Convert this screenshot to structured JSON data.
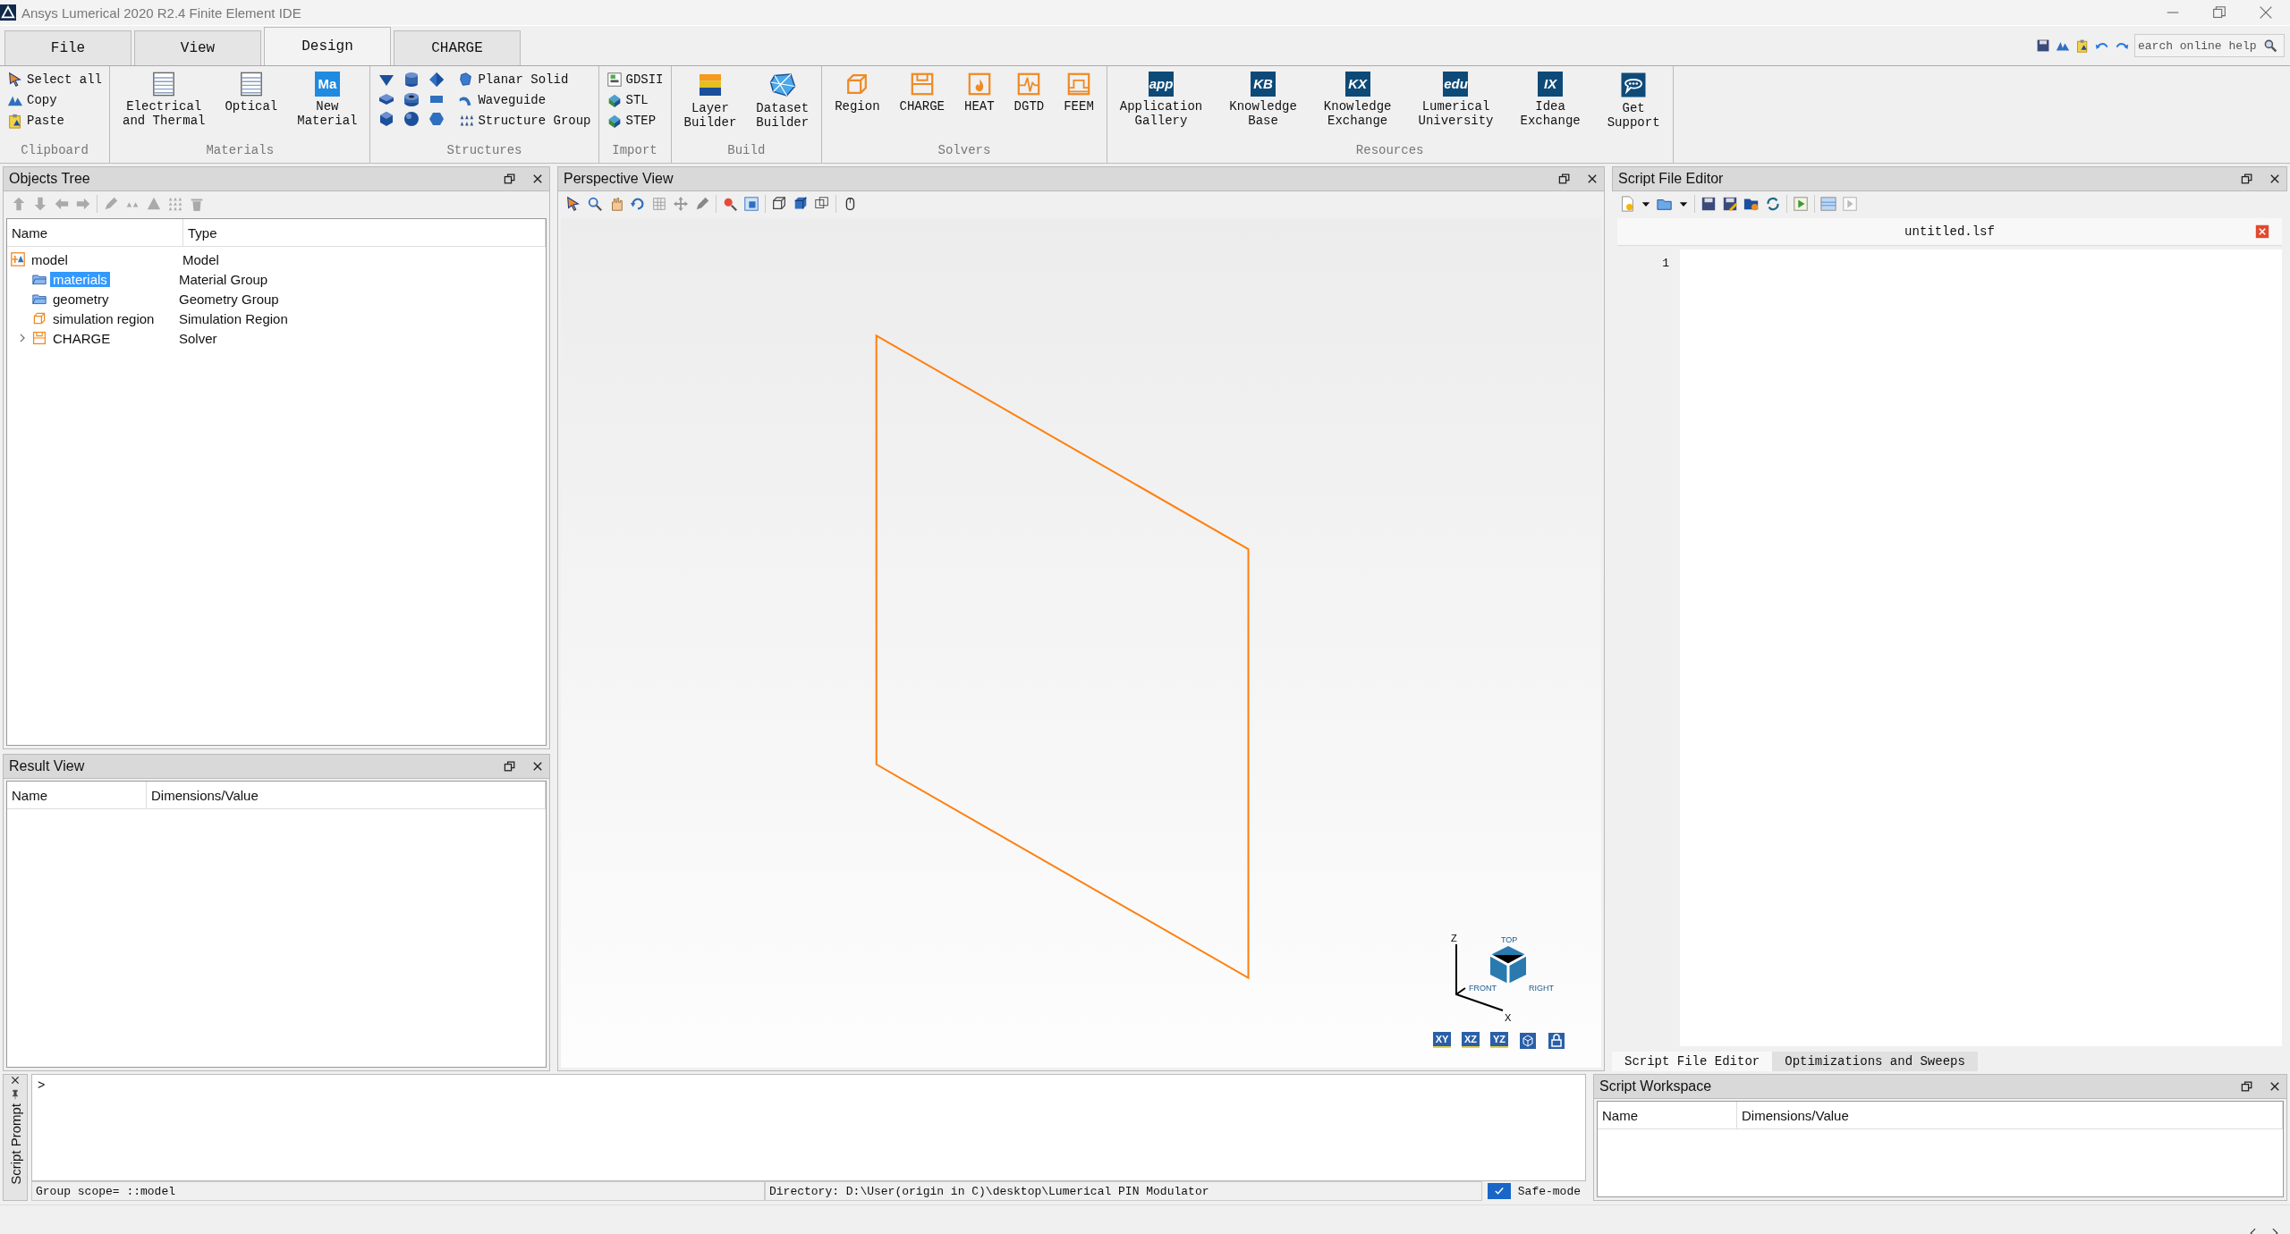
{
  "window": {
    "title": "Ansys Lumerical 2020 R2.4 Finite Element IDE"
  },
  "ribbon": {
    "tabs": [
      {
        "label": "File",
        "selected": false
      },
      {
        "label": "View",
        "selected": false
      },
      {
        "label": "Design",
        "selected": true
      },
      {
        "label": "CHARGE",
        "selected": false
      }
    ],
    "search": {
      "placeholder": "earch online help"
    },
    "groups": [
      {
        "label": "Clipboard",
        "kind": "small",
        "items": [
          {
            "label": "Select all"
          },
          {
            "label": "Copy"
          },
          {
            "label": "Paste"
          }
        ]
      },
      {
        "label": "Materials",
        "kind": "large",
        "items": [
          {
            "label": "Electrical\nand Thermal"
          },
          {
            "label": "Optical"
          },
          {
            "label": "New\nMaterial",
            "logo": "Ma"
          }
        ]
      },
      {
        "label": "Structures",
        "kind": "shapes",
        "items": [
          {
            "label": "Planar Solid"
          },
          {
            "label": "Waveguide"
          },
          {
            "label": "Structure Group"
          }
        ]
      },
      {
        "label": "Import",
        "kind": "small",
        "items": [
          {
            "label": "GDSII"
          },
          {
            "label": "STL"
          },
          {
            "label": "STEP"
          }
        ]
      },
      {
        "label": "Build",
        "kind": "large",
        "items": [
          {
            "label": "Layer\nBuilder"
          },
          {
            "label": "Dataset\nBuilder"
          }
        ]
      },
      {
        "label": "Solvers",
        "kind": "large",
        "items": [
          {
            "label": "Region"
          },
          {
            "label": "CHARGE"
          },
          {
            "label": "HEAT"
          },
          {
            "label": "DGTD"
          },
          {
            "label": "FEEM"
          }
        ]
      },
      {
        "label": "Resources",
        "kind": "large",
        "items": [
          {
            "label": "Application\nGallery",
            "logo": "app"
          },
          {
            "label": "Knowledge\nBase",
            "logo": "KB"
          },
          {
            "label": "Knowledge\nExchange",
            "logo": "KX"
          },
          {
            "label": "Lumerical\nUniversity",
            "logo": "edu"
          },
          {
            "label": "Idea\nExchange",
            "logo": "IX"
          },
          {
            "label": "Get\nSupport"
          }
        ]
      }
    ]
  },
  "objects_tree": {
    "title": "Objects Tree",
    "columns": [
      "Name",
      "Type"
    ],
    "rows": [
      {
        "name": "model",
        "type": "Model",
        "selected": false,
        "children": [
          {
            "name": "materials",
            "type": "Material Group",
            "selected": true
          },
          {
            "name": "geometry",
            "type": "Geometry Group",
            "selected": false
          },
          {
            "name": "simulation region",
            "type": "Simulation Region",
            "selected": false
          },
          {
            "name": "CHARGE",
            "type": "Solver",
            "selected": false,
            "expanded": false
          }
        ]
      }
    ]
  },
  "result_view": {
    "title": "Result View",
    "columns": [
      "Name",
      "Dimensions/Value"
    ]
  },
  "perspective_view": {
    "title": "Perspective View",
    "axes": [
      "Z",
      "X"
    ],
    "cube_faces": [
      "TOP",
      "FRONT",
      "RIGHT"
    ],
    "view_buttons": [
      "XY",
      "XZ",
      "YZ"
    ]
  },
  "script_editor": {
    "title": "Script File Editor",
    "file": "untitled.lsf",
    "line_numbers": [
      "1"
    ],
    "tabs": [
      {
        "label": "Script File Editor",
        "selected": true
      },
      {
        "label": "Optimizations and Sweeps",
        "selected": false
      }
    ]
  },
  "script_prompt": {
    "title": "Script Prompt",
    "prompt": ">",
    "group_scope": "Group scope= ::model",
    "directory": "Directory: D:\\User(origin in C)\\desktop\\Lumerical PIN Modulator",
    "safe_mode": {
      "label": "Safe-mode",
      "checked": true
    }
  },
  "script_workspace": {
    "title": "Script Workspace",
    "columns": [
      "Name",
      "Dimensions/Value"
    ]
  }
}
